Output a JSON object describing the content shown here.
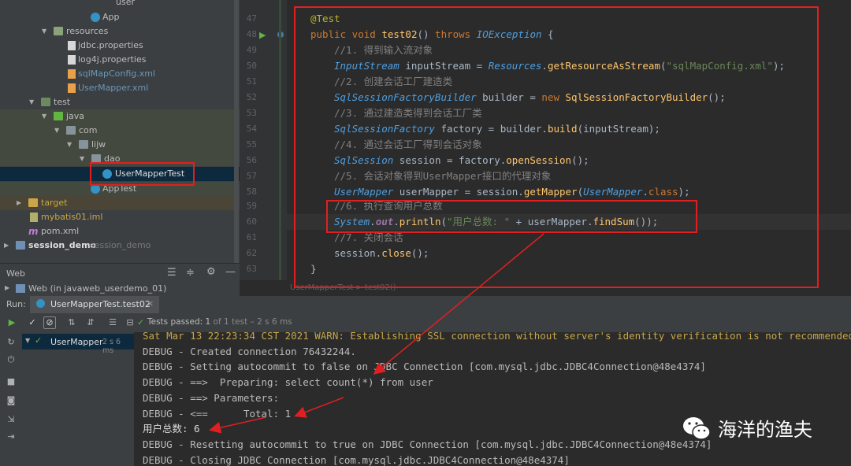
{
  "project_tree": [
    {
      "label": "App",
      "icon": "class-icon"
    },
    {
      "label": "resources",
      "icon": "folder-icon"
    },
    {
      "label": "jdbc.properties",
      "icon": "properties-file-icon"
    },
    {
      "label": "log4j.properties",
      "icon": "properties-file-icon"
    },
    {
      "label": "sqlMapConfig.xml",
      "icon": "xml-file-icon"
    },
    {
      "label": "UserMapper.xml",
      "icon": "xml-file-icon"
    },
    {
      "label": "test",
      "icon": "folder-icon"
    },
    {
      "label": "java",
      "icon": "folder-icon"
    },
    {
      "label": "com",
      "icon": "package-icon"
    },
    {
      "label": "lijw",
      "icon": "package-icon"
    },
    {
      "label": "dao",
      "icon": "package-icon"
    },
    {
      "label": "UserMapperTest",
      "icon": "class-icon"
    },
    {
      "label": "AppTest",
      "icon": "class-icon"
    },
    {
      "label": "target",
      "icon": "folder-icon"
    },
    {
      "label": "mybatis01.iml",
      "icon": "iml-file-icon"
    },
    {
      "label": "pom.xml",
      "icon": "maven-icon"
    },
    {
      "label": "session_demo",
      "suffix": "session_demo",
      "icon": "module-icon"
    }
  ],
  "web_panel": {
    "title": "Web",
    "item": "Web (in javaweb_userdemo_01)"
  },
  "editor": {
    "line_numbers": [
      "47",
      "48",
      "49",
      "50",
      "51",
      "52",
      "53",
      "54",
      "55",
      "56",
      "57",
      "58",
      "59",
      "60",
      "61",
      "62",
      "63"
    ],
    "breadcrumb": "UserMapperTest > test02()",
    "code": {
      "l47": "@Test",
      "l48_kw1": "public void ",
      "l48_fn": "test02",
      "l48_p": "() ",
      "l48_kw2": "throws ",
      "l48_ty": "IOException",
      "l48_end": " {",
      "l49": "//1. 得到输入流对象",
      "l50_ty": "InputStream",
      "l50_a": " inputStream = ",
      "l50_ty2": "Resources",
      "l50_b": ".",
      "l50_fn": "getResourceAsStream",
      "l50_c": "(",
      "l50_str": "\"sqlMapConfig.xml\"",
      "l50_d": ");",
      "l51": "//2. 创建会话工厂建造类",
      "l52_ty": "SqlSessionFactoryBuilder",
      "l52_a": " builder = ",
      "l52_kw": "new ",
      "l52_fn": "SqlSessionFactoryBuilder",
      "l52_b": "();",
      "l53": "//3. 通过建造类得到会话工厂类",
      "l54_ty": "SqlSessionFactory",
      "l54_a": " factory = builder.",
      "l54_fn": "build",
      "l54_b": "(inputStream);",
      "l55": "//4. 通过会话工厂得到会话对象",
      "l56_ty": "SqlSession",
      "l56_a": " session = factory.",
      "l56_fn": "openSession",
      "l56_b": "();",
      "l57": "//5. 会话对象得到UserMapper接口的代理对象",
      "l58_ty": "UserMapper",
      "l58_a": " userMapper = session.",
      "l58_fn": "getMapper",
      "l58_b": "(",
      "l58_ty2": "UserMapper",
      "l58_c": ".",
      "l58_kw": "class",
      "l58_d": ");",
      "l59": "//6. 执行查询用户总数",
      "l60_ty": "System",
      "l60_a": ".",
      "l60_out": "out",
      "l60_b": ".",
      "l60_fn": "println",
      "l60_c": "(",
      "l60_str": "\"用户总数: \"",
      "l60_d": " + userMapper.",
      "l60_fn2": "findSum",
      "l60_e": "());",
      "l61": "//7. 关闭会话",
      "l62_a": "session.",
      "l62_fn": "close",
      "l62_b": "();",
      "l63": "}"
    }
  },
  "run": {
    "label": "Run:",
    "tab": "UserMapperTest.test02",
    "status_prefix": "Tests passed: ",
    "status_count": "1",
    "status_suffix": " of 1 test – 2 s 6 ms",
    "tree_item": "UserMapper",
    "tree_time": "2 s 6 ms"
  },
  "console_lines": [
    "Sat Mar 13 22:23:34 CST 2021 WARN: Establishing SSL connection without server's identity verification is not recommended",
    "DEBUG - Created connection 76432244.",
    "DEBUG - Setting autocommit to false on JDBC Connection [com.mysql.jdbc.JDBC4Connection@48e4374]",
    "DEBUG - ==>  Preparing: select count(*) from user",
    "DEBUG - ==> Parameters:",
    "DEBUG - <==      Total: 1",
    "用户总数: 6",
    "DEBUG - Resetting autocommit to true on JDBC Connection [com.mysql.jdbc.JDBC4Connection@48e4374]",
    "DEBUG - Closing JDBC Connection [com.mysql.jdbc.JDBC4Connection@48e4374]"
  ],
  "watermark": "海洋的渔夫",
  "colors": {
    "highlight_box": "#e02020",
    "editor_bg": "#2b2b2b",
    "panel_bg": "#3c3f41"
  }
}
